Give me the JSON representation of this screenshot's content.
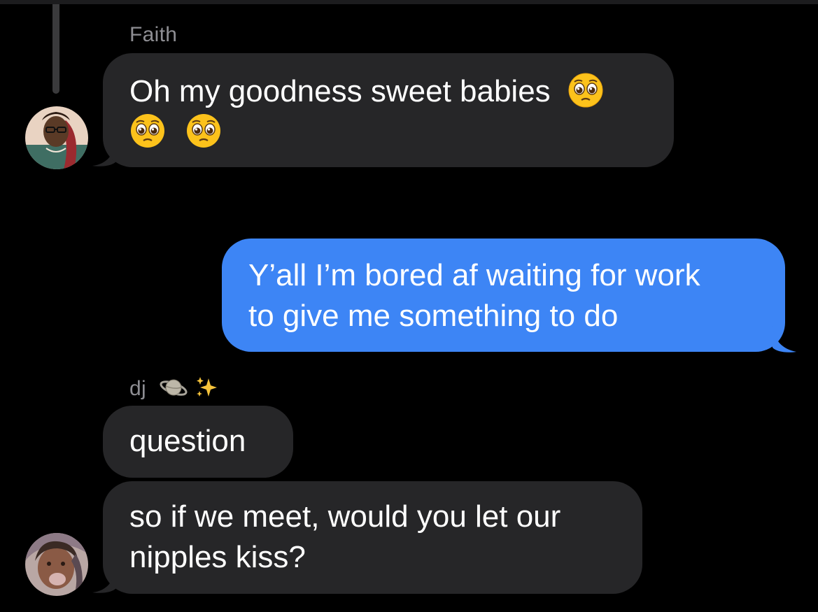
{
  "messages": [
    {
      "sender": "Faith",
      "lines": [
        "Oh my goodness sweet babies"
      ],
      "emoji_line_2_count": 2,
      "emoji": "pleading-face"
    },
    {
      "sender": "me",
      "lines": [
        "Y’all I’m bored af waiting for work",
        "to give me something to do"
      ]
    },
    {
      "sender": "dj",
      "sender_emojis": [
        "ringed-planet",
        "sparkles"
      ],
      "lines": [
        "question"
      ]
    },
    {
      "sender": "dj",
      "lines": [
        "so if we meet, would you let our",
        "nipples kiss?"
      ]
    }
  ],
  "colors": {
    "background": "#000000",
    "incoming_bubble": "#262628",
    "outgoing_bubble": "#3d85f5",
    "sender_name": "#8e8e93",
    "text": "#ffffff"
  }
}
